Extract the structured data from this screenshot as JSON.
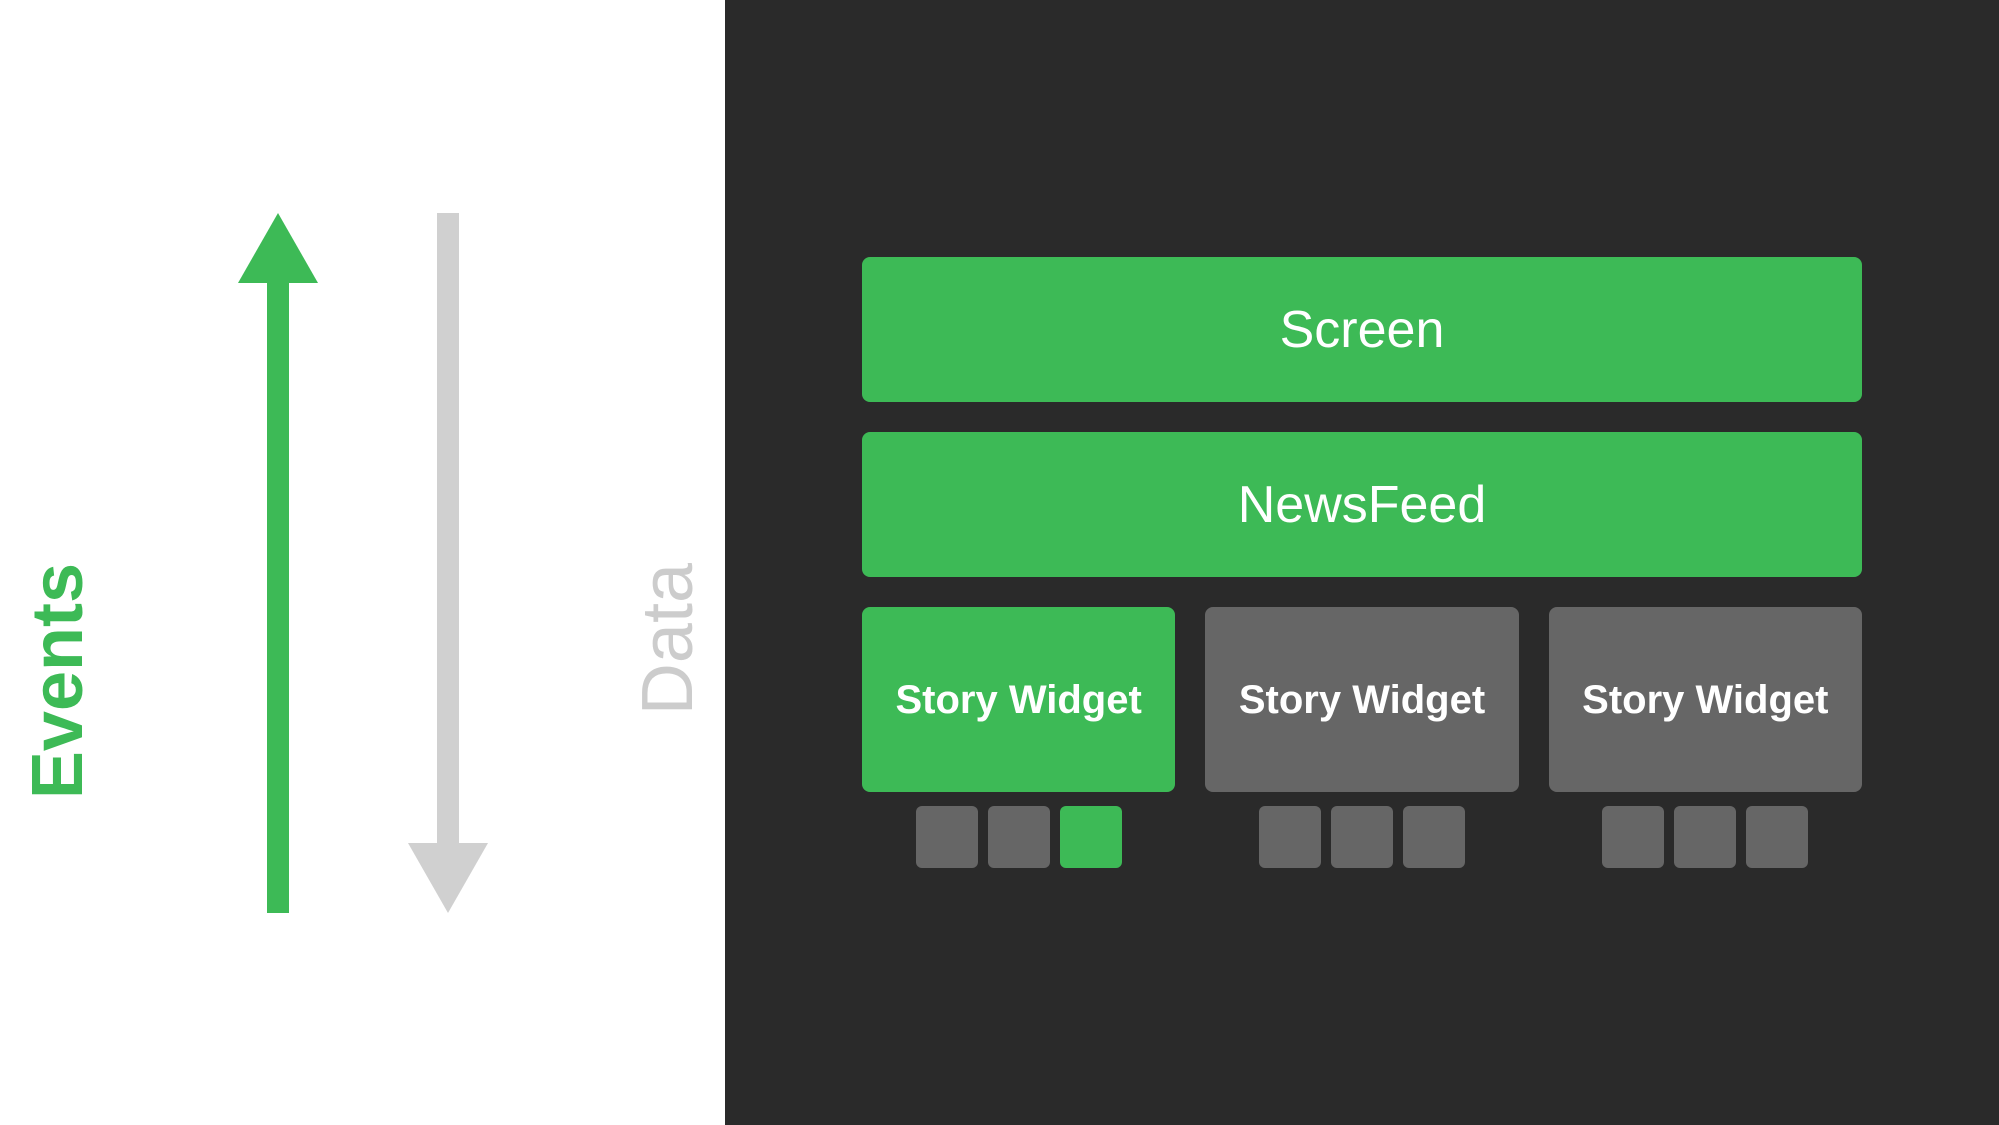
{
  "left": {
    "events_label": "Events",
    "data_label": "Data"
  },
  "right": {
    "screen_label": "Screen",
    "newsfeed_label": "NewsFeed",
    "story_widgets": [
      {
        "label": "Story Widget",
        "color": "green",
        "mini_boxes": [
          {
            "color": "gray"
          },
          {
            "color": "gray"
          },
          {
            "color": "green"
          }
        ]
      },
      {
        "label": "Story Widget",
        "color": "gray",
        "mini_boxes": [
          {
            "color": "gray"
          },
          {
            "color": "gray"
          },
          {
            "color": "gray"
          }
        ]
      },
      {
        "label": "Story Widget",
        "color": "gray",
        "mini_boxes": [
          {
            "color": "gray"
          },
          {
            "color": "gray"
          },
          {
            "color": "gray"
          }
        ]
      }
    ]
  }
}
